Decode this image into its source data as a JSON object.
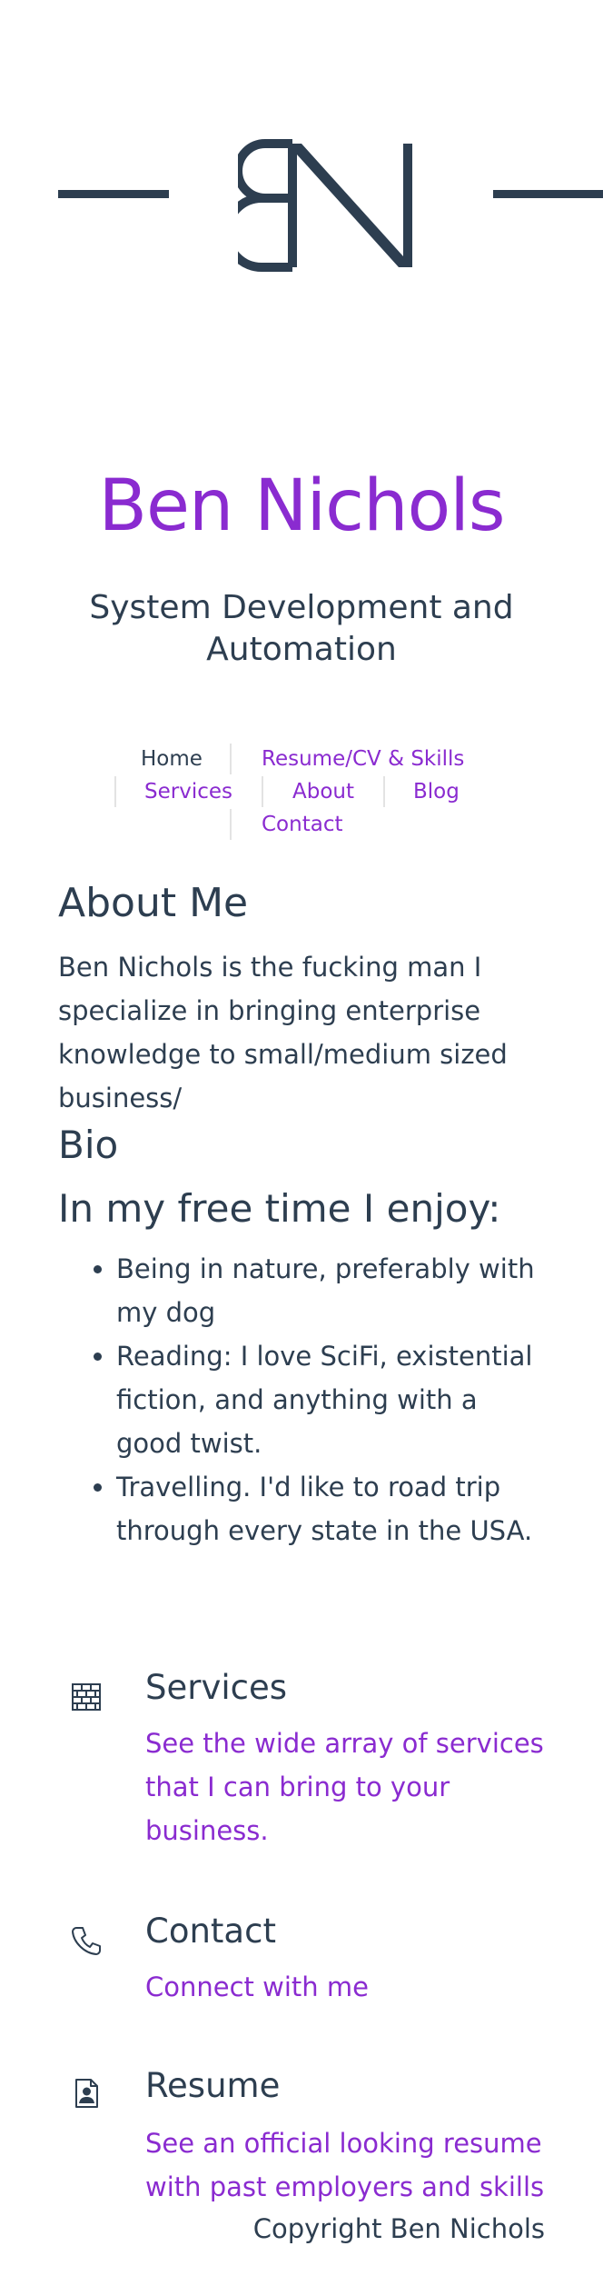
{
  "site": {
    "logo_alt": "BN",
    "title": "Ben Nichols",
    "tagline": "System Development and Automation"
  },
  "nav": {
    "home": "Home",
    "resume": "Resume/CV & Skills",
    "services": "Services",
    "about": "About",
    "blog": "Blog",
    "contact": "Contact"
  },
  "about": {
    "heading": "About Me",
    "intro": "Ben Nichols is the fucking man I specialize in bringing enterprise knowledge to small/medium sized business/",
    "bio_heading": "Bio",
    "free_time_heading": "In my free time I enjoy:",
    "interests": [
      "Being in nature, preferably with my dog",
      "Reading: I love SciFi, existential fiction, and anything with a good twist.",
      "Travelling. I'd like to road trip through every state in the USA."
    ]
  },
  "features": [
    {
      "icon": "brick-wall-icon",
      "title": "Services",
      "link_text": "See the wide array of services that I can bring to your business."
    },
    {
      "icon": "phone-icon",
      "title": "Contact",
      "link_text": "Connect with me"
    },
    {
      "icon": "resume-document-icon",
      "title": "Resume",
      "link_text": "See an official looking resume with past employers and skills"
    }
  ],
  "footer": {
    "copyright": "Copyright Ben Nichols"
  },
  "colors": {
    "accent": "#8a2bd0",
    "text": "#2d3e50",
    "separator": "#e3e3e3",
    "background": "#ffffff"
  }
}
